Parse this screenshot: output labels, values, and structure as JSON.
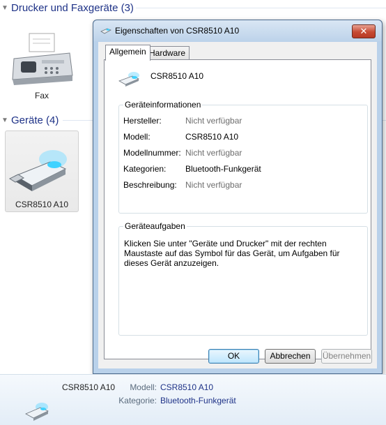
{
  "background": {
    "printers_group": {
      "title": "Drucker und Faxgeräte (3)"
    },
    "fax_device": {
      "label": "Fax"
    },
    "devices_group": {
      "title": "Geräte (4)"
    },
    "selected_device": {
      "label": "CSR8510 A10"
    }
  },
  "dialog": {
    "title": "Eigenschaften von CSR8510 A10",
    "close_label": "✕",
    "tabs": [
      {
        "label": "Allgemein",
        "active": true
      },
      {
        "label": "Hardware",
        "active": false
      }
    ],
    "device_name": "CSR8510 A10",
    "info_group": {
      "title": "Geräteinformationen",
      "rows": [
        {
          "label": "Hersteller:",
          "value": "Nicht verfügbar",
          "available": false
        },
        {
          "label": "Modell:",
          "value": "CSR8510 A10",
          "available": true
        },
        {
          "label": "Modellnummer:",
          "value": "Nicht verfügbar",
          "available": false
        },
        {
          "label": "Kategorien:",
          "value": "Bluetooth-Funkgerät",
          "available": true
        },
        {
          "label": "Beschreibung:",
          "value": "Nicht verfügbar",
          "available": false
        }
      ]
    },
    "tasks_group": {
      "title": "Geräteaufgaben",
      "text": "Klicken Sie unter \"Geräte und Drucker\" mit der rechten Maustaste auf das Symbol für das Gerät, um Aufgaben für dieses Gerät anzuzeigen."
    },
    "buttons": {
      "ok": "OK",
      "cancel": "Abbrechen",
      "apply": "Übernehmen"
    }
  },
  "details_pane": {
    "name": "CSR8510 A10",
    "model_label": "Modell:",
    "model_value": "CSR8510 A10",
    "category_label": "Kategorie:",
    "category_value": "Bluetooth-Funkgerät"
  },
  "icons": {
    "device": "usb-bluetooth-dongle-icon",
    "fax": "fax-machine-icon",
    "close": "close-icon",
    "chevron": "chevron-down-icon"
  },
  "colors": {
    "group_header": "#1e3287",
    "dialog_frame": "#b9d1ea",
    "close_button": "#c64a33",
    "muted_value": "#6d6d6d"
  }
}
